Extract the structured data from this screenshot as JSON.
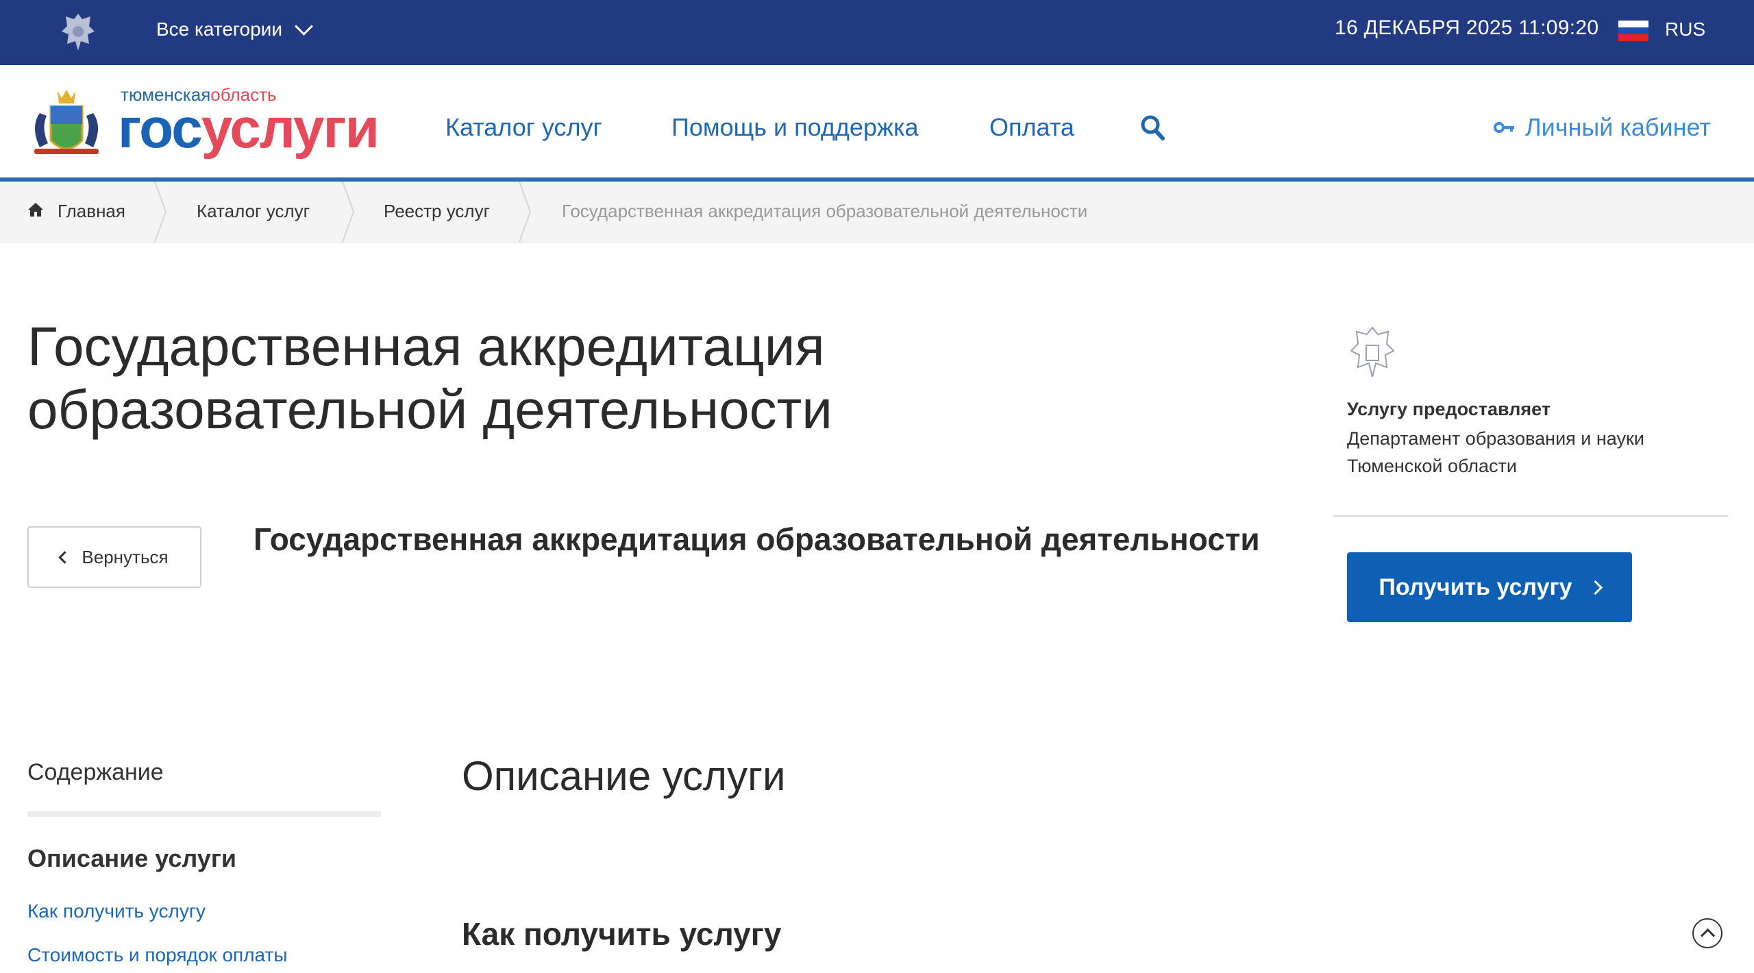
{
  "topbar": {
    "categories_label": "Все категории",
    "datetime": "16 ДЕКАБРЯ 2025 11:09:20",
    "language": "RUS"
  },
  "logo": {
    "region_part1": "тюменская",
    "region_part2": "область",
    "main_part1": "гос",
    "main_part2": "услуги"
  },
  "nav": {
    "catalog": "Каталог услуг",
    "help": "Помощь и поддержка",
    "payment": "Оплата",
    "cabinet": "Личный кабинет"
  },
  "breadcrumb": {
    "items": [
      "Главная",
      "Каталог услуг",
      "Реестр услуг",
      "Государственная аккредитация образовательной деятельности"
    ]
  },
  "service": {
    "title": "Государственная аккредитация образовательной деятельности",
    "subtitle": "Государственная аккредитация образовательной деятельности",
    "back_label": "Вернуться",
    "provider_label": "Услугу предоставляет",
    "provider_name": "Департамент образования и науки Тюменской области",
    "get_button": "Получить услугу"
  },
  "toc": {
    "title": "Содержание",
    "active": "Описание услуги",
    "links": [
      "Как получить услугу",
      "Стоимость и порядок оплаты"
    ]
  },
  "content": {
    "section_title": "Описание услуги",
    "section_sub": "Как получить услугу"
  },
  "colors": {
    "topbar": "#223a82",
    "accent_blue": "#1f67b1",
    "button_blue": "#0f5fb5",
    "logo_red": "#e54a5a"
  },
  "icons": [
    "emblem-icon",
    "chevron-down-icon",
    "flag-ru-icon",
    "search-icon",
    "key-icon",
    "home-icon",
    "chevron-left-icon",
    "chevron-right-icon",
    "arrow-up-icon"
  ]
}
